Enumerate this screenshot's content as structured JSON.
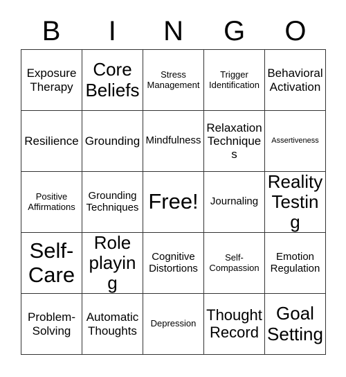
{
  "card": {
    "header": {
      "letters": [
        "B",
        "I",
        "N",
        "G",
        "O"
      ]
    },
    "grid": {
      "rows": 5,
      "columns": 5,
      "border_color": "#333333",
      "background_color": "#ffffff",
      "text_color": "#000000",
      "cells": [
        {
          "text": "Exposure\nTherapy",
          "size": "fs-l"
        },
        {
          "text": "Core\nBeliefs",
          "size": "fs-xxl"
        },
        {
          "text": "Stress\nManagement",
          "size": "fs-s"
        },
        {
          "text": "Trigger\nIdentification",
          "size": "fs-s"
        },
        {
          "text": "Behavioral\nActivation",
          "size": "fs-l"
        },
        {
          "text": "Resilience",
          "size": "fs-l"
        },
        {
          "text": "Grounding",
          "size": "fs-l"
        },
        {
          "text": "Mindfulness",
          "size": "fs-m"
        },
        {
          "text": "Relaxation\nTechniques",
          "size": "fs-l"
        },
        {
          "text": "Assertiveness",
          "size": "fs-xs"
        },
        {
          "text": "Positive\nAffirmations",
          "size": "fs-s"
        },
        {
          "text": "Grounding\nTechniques",
          "size": "fs-m"
        },
        {
          "text": "Free!",
          "size": "fs-3xl"
        },
        {
          "text": "Journaling",
          "size": "fs-m"
        },
        {
          "text": "Reality\nTesting",
          "size": "fs-xxl"
        },
        {
          "text": "Self-\nCare",
          "size": "fs-3xl"
        },
        {
          "text": "Role\nplaying",
          "size": "fs-xxl"
        },
        {
          "text": "Cognitive\nDistortions",
          "size": "fs-m"
        },
        {
          "text": "Self-\nCompassion",
          "size": "fs-s"
        },
        {
          "text": "Emotion\nRegulation",
          "size": "fs-m"
        },
        {
          "text": "Problem-\nSolving",
          "size": "fs-l"
        },
        {
          "text": "Automatic\nThoughts",
          "size": "fs-l"
        },
        {
          "text": "Depression",
          "size": "fs-s"
        },
        {
          "text": "Thought\nRecord",
          "size": "fs-xl"
        },
        {
          "text": "Goal\nSetting",
          "size": "fs-xxl"
        }
      ]
    }
  }
}
